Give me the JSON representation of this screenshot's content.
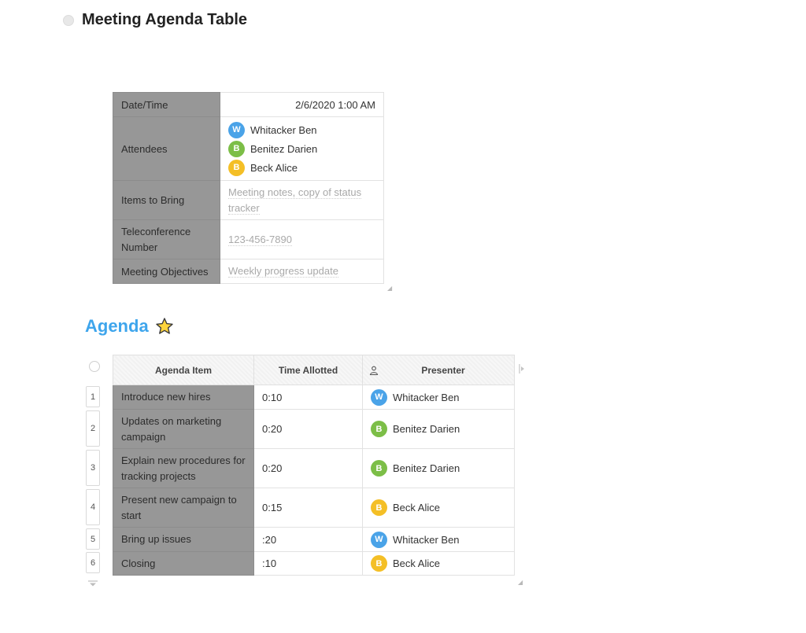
{
  "page": {
    "title": "Meeting Agenda Table"
  },
  "info_table": {
    "rows": [
      {
        "label": "Date/Time",
        "value": "2/6/2020 1:00 AM"
      },
      {
        "label": "Attendees"
      },
      {
        "label": "Items to Bring",
        "placeholder": "Meeting notes, copy of status tracker"
      },
      {
        "label": "Teleconference Number",
        "placeholder": "123-456-7890"
      },
      {
        "label": "Meeting Objectives",
        "placeholder": "Weekly progress update"
      }
    ],
    "attendees": [
      {
        "initial": "W",
        "name": "Whitacker Ben",
        "color": "#4aa3e8"
      },
      {
        "initial": "B",
        "name": "Benitez Darien",
        "color": "#7cbe47"
      },
      {
        "initial": "B",
        "name": "Beck Alice",
        "color": "#f4bf26"
      }
    ]
  },
  "agenda": {
    "title": "Agenda",
    "title_icon": "star-icon",
    "columns": {
      "item": "Agenda Item",
      "time": "Time Allotted",
      "presenter": "Presenter"
    },
    "rows": [
      {
        "num": "1",
        "item": "Introduce new hires",
        "time": "0:10",
        "initial": "W",
        "presenter": "Whitacker Ben",
        "color": "#4aa3e8"
      },
      {
        "num": "2",
        "item": "Updates on marketing campaign",
        "time": "0:20",
        "initial": "B",
        "presenter": "Benitez Darien",
        "color": "#7cbe47"
      },
      {
        "num": "3",
        "item": "Explain new procedures for tracking projects",
        "time": "0:20",
        "initial": "B",
        "presenter": "Benitez Darien",
        "color": "#7cbe47"
      },
      {
        "num": "4",
        "item": "Present new campaign to start",
        "time": "0:15",
        "initial": "B",
        "presenter": "Beck Alice",
        "color": "#f4bf26"
      },
      {
        "num": "5",
        "item": "Bring up issues",
        "time": ":20",
        "initial": "W",
        "presenter": "Whitacker Ben",
        "color": "#4aa3e8"
      },
      {
        "num": "6",
        "item": "Closing",
        "time": ":10",
        "initial": "B",
        "presenter": "Beck Alice",
        "color": "#f4bf26"
      }
    ]
  },
  "colors": {
    "accent": "#3ea5ec",
    "label_cell_bg": "#979797",
    "placeholder": "#a9a9a9"
  }
}
